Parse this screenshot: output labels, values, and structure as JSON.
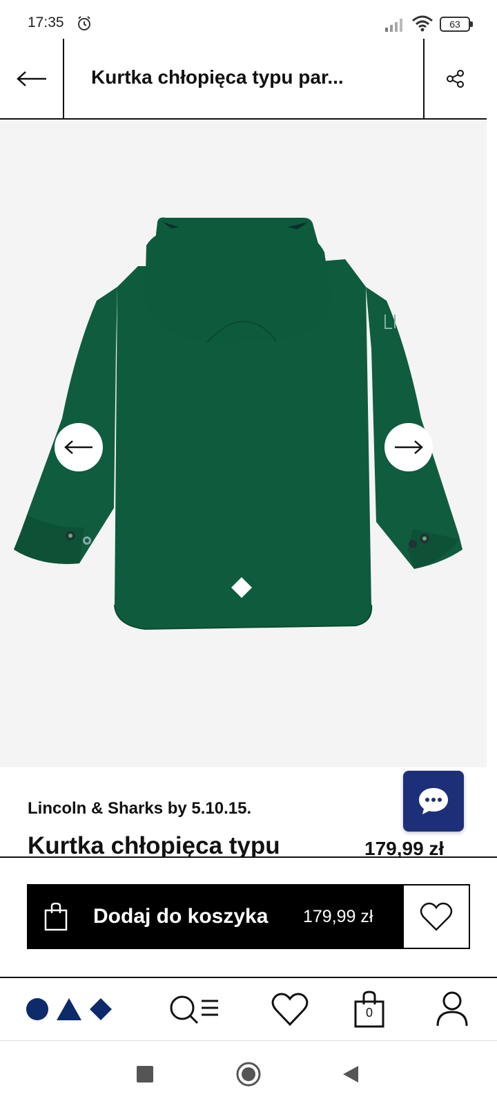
{
  "status_bar": {
    "time": "17:35",
    "battery": "63"
  },
  "header": {
    "title": "Kurtka chłopięca typu par...",
    "back_icon": "arrow-left-icon",
    "share_icon": "share-icon"
  },
  "gallery": {
    "prev_icon": "arrow-left-icon",
    "next_icon": "arrow-right-icon",
    "jacket_color": "#0f5b3d"
  },
  "product": {
    "brand": "Lincoln & Sharks by 5.10.15.",
    "name": "Kurtka chłopięca typu",
    "price": "179,99 zł"
  },
  "cart_bar": {
    "add_label": "Dodaj do koszyka",
    "price": "179,99 zł"
  },
  "bottom_nav": {
    "cart_count": "0"
  },
  "colors": {
    "accent_navy": "#1e2f7a",
    "brand_navy": "#0d2a6b"
  }
}
